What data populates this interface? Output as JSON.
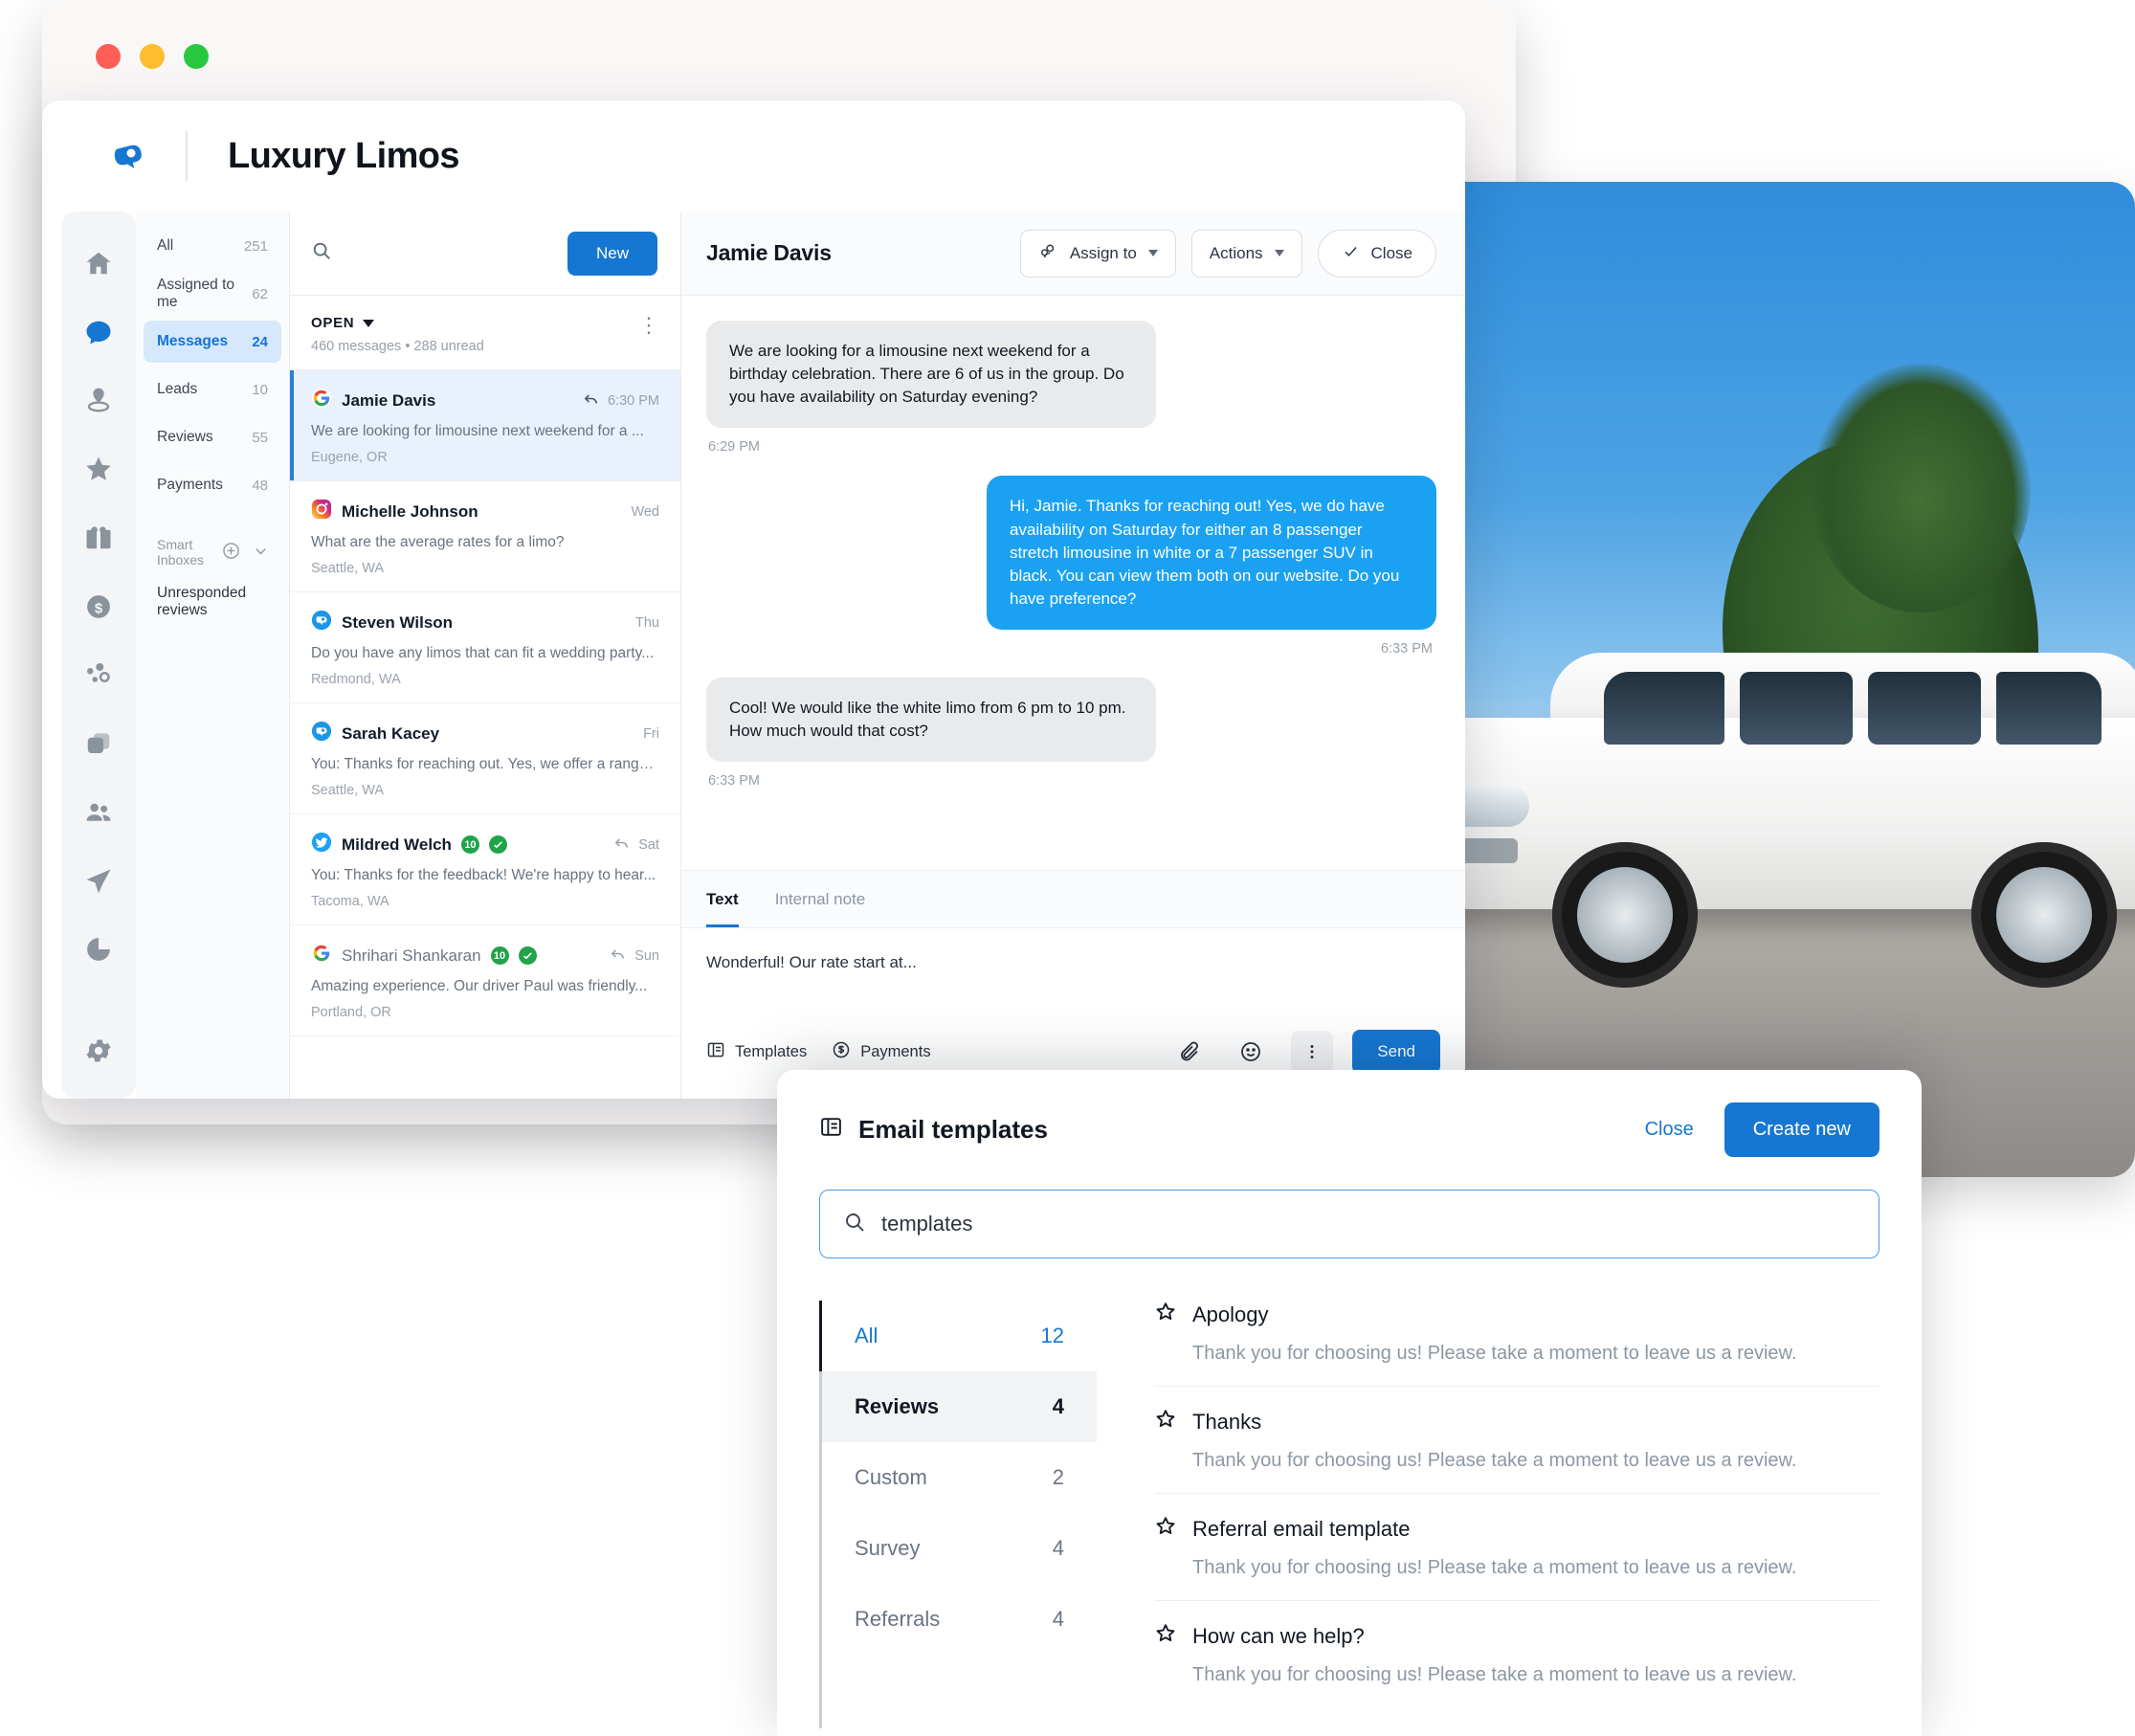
{
  "window": {
    "traffic_lights": [
      "close",
      "minimize",
      "maximize"
    ]
  },
  "app": {
    "brand_title": "Luxury Limos",
    "accent_color": "#1677d2",
    "rail_items": [
      {
        "name": "home-icon",
        "label": "Home",
        "active": false
      },
      {
        "name": "messages-icon",
        "label": "Messages",
        "active": true
      },
      {
        "name": "location-icon",
        "label": "Locations",
        "active": false
      },
      {
        "name": "reviews-star-icon",
        "label": "Reviews",
        "active": false
      },
      {
        "name": "referrals-gift-icon",
        "label": "Referrals",
        "active": false
      },
      {
        "name": "payments-dollar-icon",
        "label": "Payments",
        "active": false
      },
      {
        "name": "automations-icon",
        "label": "Automations",
        "active": false
      },
      {
        "name": "pages-icon",
        "label": "Pages",
        "active": false
      },
      {
        "name": "contacts-people-icon",
        "label": "Contacts",
        "active": false
      },
      {
        "name": "campaigns-send-icon",
        "label": "Campaigns",
        "active": false
      },
      {
        "name": "reports-pie-icon",
        "label": "Reports",
        "active": false
      },
      {
        "name": "settings-gear-icon",
        "label": "Settings",
        "active": false
      }
    ]
  },
  "folders": {
    "items": [
      {
        "label": "All",
        "count": "251",
        "active": false
      },
      {
        "label": "Assigned to me",
        "count": "62",
        "active": false
      },
      {
        "label": "Messages",
        "count": "24",
        "active": true
      },
      {
        "label": "Leads",
        "count": "10",
        "active": false
      },
      {
        "label": "Reviews",
        "count": "55",
        "active": false
      },
      {
        "label": "Payments",
        "count": "48",
        "active": false
      }
    ],
    "smart_inboxes_label": "Smart Inboxes",
    "unresponded_label": "Unresponded reviews"
  },
  "conversations": {
    "new_button": "New",
    "status_label": "OPEN",
    "count_text": "460 messages • 288 unread",
    "items": [
      {
        "name": "Jamie Davis",
        "channel": "google",
        "time": "6:30 PM",
        "replied": true,
        "snippet": "We are looking for limousine next weekend for a ...",
        "location": "Eugene, OR",
        "selected": true,
        "unread": true,
        "rating_badge": "",
        "green_dot": false
      },
      {
        "name": "Michelle Johnson",
        "channel": "instagram",
        "time": "Wed",
        "replied": false,
        "snippet": "What are the average rates for a limo?",
        "location": "Seattle, WA",
        "selected": false,
        "unread": true,
        "rating_badge": "",
        "green_dot": false
      },
      {
        "name": "Steven Wilson",
        "channel": "birdeye",
        "time": "Thu",
        "replied": false,
        "snippet": "Do you have any limos that can fit a wedding party...",
        "location": "Redmond, WA",
        "selected": false,
        "unread": true,
        "rating_badge": "",
        "green_dot": false
      },
      {
        "name": "Sarah Kacey",
        "channel": "birdeye",
        "time": "Fri",
        "replied": false,
        "snippet": "You: Thanks for reaching out. Yes, we offer a range...",
        "location": "Seattle, WA",
        "selected": false,
        "unread": true,
        "rating_badge": "",
        "green_dot": false
      },
      {
        "name": "Mildred Welch",
        "channel": "twitter",
        "time": "Sat",
        "replied": true,
        "snippet": "You: Thanks for the feedback! We're happy to hear...",
        "location": "Tacoma, WA",
        "selected": false,
        "unread": true,
        "rating_badge": "10",
        "green_dot": true
      },
      {
        "name": "Shrihari Shankaran",
        "channel": "google",
        "time": "Sun",
        "replied": true,
        "snippet": "Amazing experience. Our driver Paul was friendly...",
        "location": "Portland, OR",
        "selected": false,
        "unread": false,
        "rating_badge": "10",
        "green_dot": true
      }
    ]
  },
  "thread": {
    "contact_name": "Jamie Davis",
    "assign_label": "Assign to",
    "actions_label": "Actions",
    "close_label": "Close",
    "messages": [
      {
        "direction": "in",
        "text": "We are looking for a limousine next weekend for a birthday celebration. There are 6 of us in the group. Do you have availability on Saturday evening?",
        "time": "6:29 PM"
      },
      {
        "direction": "out",
        "text": "Hi, Jamie. Thanks for reaching out! Yes, we do have availability on Saturday for either an 8 passenger stretch limousine in white or a 7 passenger SUV in black. You can view them both on our website. Do you have preference?",
        "time": "6:33 PM"
      },
      {
        "direction": "in",
        "text": "Cool! We would like the white limo from 6 pm to 10 pm. How much would that cost?",
        "time": "6:33 PM"
      }
    ]
  },
  "composer": {
    "tabs": [
      {
        "label": "Text",
        "active": true
      },
      {
        "label": "Internal note",
        "active": false
      }
    ],
    "draft_text": "Wonderful! Our rate start at...",
    "templates_label": "Templates",
    "payments_label": "Payments",
    "send_label": "Send"
  },
  "templates_panel": {
    "title": "Email templates",
    "close_label": "Close",
    "create_label": "Create new",
    "search_value": "templates",
    "categories": [
      {
        "label": "All",
        "count": "12",
        "style": "blue"
      },
      {
        "label": "Reviews",
        "count": "4",
        "style": "selected"
      },
      {
        "label": "Custom",
        "count": "2",
        "style": "normal"
      },
      {
        "label": "Survey",
        "count": "4",
        "style": "normal"
      },
      {
        "label": "Referrals",
        "count": "4",
        "style": "normal"
      }
    ],
    "items": [
      {
        "title": "Apology",
        "preview": "Thank you for choosing us! Please take a moment to leave us a review."
      },
      {
        "title": "Thanks",
        "preview": "Thank you for choosing us! Please take a moment to leave us a review."
      },
      {
        "title": "Referral email template",
        "preview": "Thank you for choosing us! Please take a moment to leave us a review."
      },
      {
        "title": "How can we help?",
        "preview": "Thank you for choosing us! Please take a moment to leave us a review."
      }
    ]
  }
}
